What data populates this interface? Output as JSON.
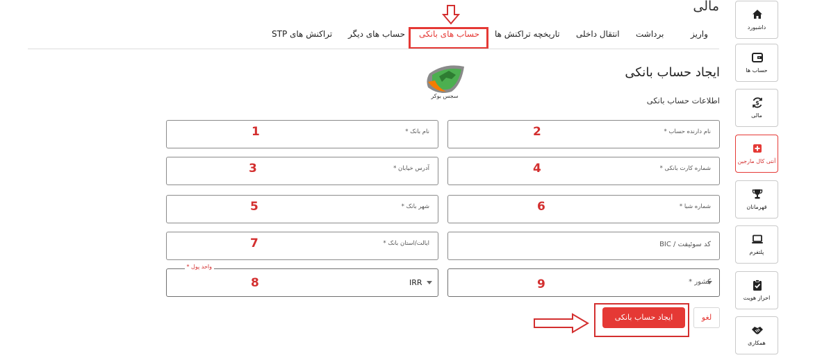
{
  "page": {
    "heading": "مالی"
  },
  "tabs": [
    {
      "label": "واریز"
    },
    {
      "label": "برداشت"
    },
    {
      "label": "انتقال داخلی"
    },
    {
      "label": "تاریخچه تراکنش ها"
    },
    {
      "label": "حساب های بانکی",
      "active": true
    },
    {
      "label": "حساب های دیگر"
    },
    {
      "label": "تراکنش های STP"
    }
  ],
  "form": {
    "title": "ایجاد حساب بانکی",
    "subtitle": "اطلاعات حساب بانکی",
    "logo_text": "سجس بوکر",
    "fields": {
      "bank_name": {
        "placeholder": "نام بانک *",
        "number": "1"
      },
      "account_holder": {
        "placeholder": "نام دارنده حساب *",
        "number": "2"
      },
      "street_address": {
        "placeholder": "آدرس خیابان *",
        "number": "3"
      },
      "card_number": {
        "placeholder": "شماره کارت بانکی *",
        "number": "4"
      },
      "bank_city": {
        "placeholder": "شهر بانک *",
        "number": "5"
      },
      "sheba_number": {
        "placeholder": "شماره شبا *",
        "number": "6"
      },
      "bank_state": {
        "placeholder": "ایالت/استان بانک *",
        "number": "7"
      },
      "swift_code": {
        "placeholder": "کد سوئیفت / BIC"
      },
      "currency": {
        "label": "واحد پول *",
        "value": "IRR",
        "number": "8"
      },
      "country": {
        "placeholder": "کشور *",
        "number": "9"
      }
    },
    "buttons": {
      "cancel": "لغو",
      "create": "ایجاد حساب بانکی"
    }
  },
  "sidebar": {
    "items": [
      {
        "label": "داشبورد",
        "icon": "home-icon"
      },
      {
        "label": "حساب ها",
        "icon": "wallet-icon"
      },
      {
        "label": "مالی",
        "icon": "dollar-exchange-icon"
      },
      {
        "label": "آنتی کال مارجین",
        "icon": "medical-plus-icon",
        "active": true
      },
      {
        "label": "قهرمانان",
        "icon": "trophy-icon"
      },
      {
        "label": "پلتفرم",
        "icon": "laptop-icon"
      },
      {
        "label": "احراز هویت",
        "icon": "clipboard-check-icon"
      },
      {
        "label": "همکاری",
        "icon": "handshake-icon"
      }
    ]
  },
  "colors": {
    "accent": "#e53935",
    "annotation": "#d32f2f",
    "border": "#8a8a8a"
  }
}
